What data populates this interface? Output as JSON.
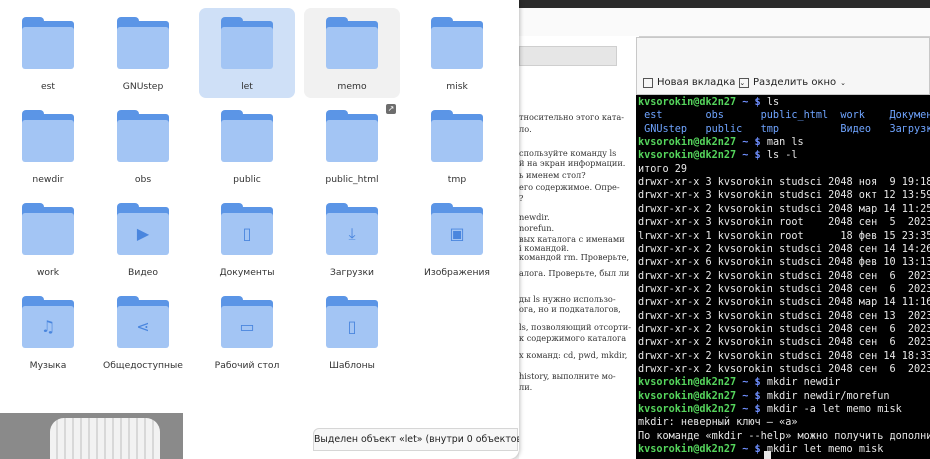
{
  "document": {
    "lines": [
      "тносительно этого ката-",
      "ло.",
      "спользуйте команду ls",
      "й на экран информации.",
      "ь именем стол?",
      "его содержимое. Опре-",
      "?",
      "newdir.",
      "norefun.",
      "вых каталога с именами",
      "і командой.",
      "командой rm. Проверьте,",
      "алога. Проверьте, был ли",
      "ды ls нужно использо-",
      "ога, но и подкаталогов,",
      "ls, позволяющий отсорти-",
      "к содержимого каталога",
      "х команд: cd, pwd, mkdir,",
      "history, выполните мо-",
      "ли."
    ]
  },
  "terminal": {
    "toolbar": {
      "new_tab": "Новая вкладка",
      "split": "Разделить окно"
    },
    "lines": [
      [
        {
          "t": "kvsorokin@dk2n27",
          "c": "u"
        },
        {
          "t": " ~ $ ",
          "c": "p"
        },
        {
          "t": "ls",
          "c": ""
        }
      ],
      [
        {
          "t": " est       obs      public_html  work    Докумен",
          "c": "d"
        }
      ],
      [
        {
          "t": " GNUstep   public   tmp          Видео   Загрузк",
          "c": "d"
        }
      ],
      [
        {
          "t": "kvsorokin@dk2n27",
          "c": "u"
        },
        {
          "t": " ~ $ ",
          "c": "p"
        },
        {
          "t": "man ls",
          "c": ""
        }
      ],
      [
        {
          "t": "kvsorokin@dk2n27",
          "c": "u"
        },
        {
          "t": " ~ $ ",
          "c": "p"
        },
        {
          "t": "ls -l",
          "c": ""
        }
      ],
      [
        {
          "t": "итого 29",
          "c": ""
        }
      ],
      [
        {
          "t": "drwxr-xr-x 3 kvsorokin studsci 2048 ноя  9 19:18",
          "c": ""
        }
      ],
      [
        {
          "t": "drwxr-xr-x 3 kvsorokin studsci 2048 окт 12 13:59",
          "c": ""
        }
      ],
      [
        {
          "t": "drwxr-xr-x 2 kvsorokin studsci 2048 мар 14 11:25",
          "c": ""
        }
      ],
      [
        {
          "t": "drwxr-xr-x 3 kvsorokin root    2048 сен  5  2023",
          "c": ""
        }
      ],
      [
        {
          "t": "lrwxr-xr-x 1 kvsorokin root      18 фев 15 23:35",
          "c": ""
        }
      ],
      [
        {
          "t": "drwxr-xr-x 2 kvsorokin studsci 2048 сен 14 14:26",
          "c": ""
        }
      ],
      [
        {
          "t": "drwxr-xr-x 6 kvsorokin studsci 2048 фев 10 13:13",
          "c": ""
        }
      ],
      [
        {
          "t": "drwxr-xr-x 2 kvsorokin studsci 2048 сен  6  2023",
          "c": ""
        }
      ],
      [
        {
          "t": "drwxr-xr-x 2 kvsorokin studsci 2048 сен  6  2023",
          "c": ""
        }
      ],
      [
        {
          "t": "drwxr-xr-x 2 kvsorokin studsci 2048 мар 14 11:16",
          "c": ""
        }
      ],
      [
        {
          "t": "drwxr-xr-x 3 kvsorokin studsci 2048 сен 13  2023",
          "c": ""
        }
      ],
      [
        {
          "t": "drwxr-xr-x 2 kvsorokin studsci 2048 сен  6  2023",
          "c": ""
        }
      ],
      [
        {
          "t": "drwxr-xr-x 2 kvsorokin studsci 2048 сен  6  2023",
          "c": ""
        }
      ],
      [
        {
          "t": "drwxr-xr-x 2 kvsorokin studsci 2048 сен 14 18:33",
          "c": ""
        }
      ],
      [
        {
          "t": "drwxr-xr-x 2 kvsorokin studsci 2048 сен  6  2023",
          "c": ""
        }
      ],
      [
        {
          "t": "kvsorokin@dk2n27",
          "c": "u"
        },
        {
          "t": " ~ $ ",
          "c": "p"
        },
        {
          "t": "mkdir newdir",
          "c": ""
        }
      ],
      [
        {
          "t": "kvsorokin@dk2n27",
          "c": "u"
        },
        {
          "t": " ~ $ ",
          "c": "p"
        },
        {
          "t": "mkdir newdir/morefun",
          "c": ""
        }
      ],
      [
        {
          "t": "kvsorokin@dk2n27",
          "c": "u"
        },
        {
          "t": " ~ $ ",
          "c": "p"
        },
        {
          "t": "mkdir -a let memo misk",
          "c": ""
        }
      ],
      [
        {
          "t": "mkdir: неверный ключ — «a»",
          "c": ""
        }
      ],
      [
        {
          "t": "По команде «mkdir --help» можно получить дополнит",
          "c": ""
        }
      ],
      [
        {
          "t": "kvsorokin@dk2n27",
          "c": "u"
        },
        {
          "t": " ~ $ ",
          "c": "p"
        },
        {
          "t": "mkdir let memo misk",
          "c": ""
        }
      ]
    ]
  },
  "file_manager": {
    "items": [
      {
        "name": "est",
        "icon": "folder-icon",
        "glyph": "",
        "state": ""
      },
      {
        "name": "GNUstep",
        "icon": "folder-icon",
        "glyph": "",
        "state": ""
      },
      {
        "name": "let",
        "icon": "folder-icon",
        "glyph": "",
        "state": "selected"
      },
      {
        "name": "memo",
        "icon": "folder-icon",
        "glyph": "",
        "state": "hovered"
      },
      {
        "name": "misk",
        "icon": "folder-icon",
        "glyph": "",
        "state": ""
      },
      {
        "name": "newdir",
        "icon": "folder-icon",
        "glyph": "",
        "state": ""
      },
      {
        "name": "obs",
        "icon": "folder-icon",
        "glyph": "",
        "state": ""
      },
      {
        "name": "public",
        "icon": "folder-icon",
        "glyph": "",
        "state": ""
      },
      {
        "name": "public_html",
        "icon": "folder-icon",
        "glyph": "",
        "state": ""
      },
      {
        "name": "tmp",
        "icon": "folder-icon",
        "glyph": "",
        "state": ""
      },
      {
        "name": "work",
        "icon": "folder-icon",
        "glyph": "",
        "state": ""
      },
      {
        "name": "Видео",
        "icon": "folder-videos-icon",
        "glyph": "▶",
        "state": ""
      },
      {
        "name": "Документы",
        "icon": "folder-documents-icon",
        "glyph": "▯",
        "state": ""
      },
      {
        "name": "Загрузки",
        "icon": "folder-download-icon",
        "glyph": "⤓",
        "state": ""
      },
      {
        "name": "Изображения",
        "icon": "folder-pictures-icon",
        "glyph": "▣",
        "state": ""
      },
      {
        "name": "Музыка",
        "icon": "folder-music-icon",
        "glyph": "♫",
        "state": ""
      },
      {
        "name": "Общедоступные",
        "icon": "folder-publicshare-icon",
        "glyph": "⋖",
        "state": ""
      },
      {
        "name": "Рабочий стол",
        "icon": "folder-desktop-icon",
        "glyph": "▭",
        "state": ""
      },
      {
        "name": "Шаблоны",
        "icon": "folder-templates-icon",
        "glyph": "▯",
        "state": ""
      }
    ],
    "status": "Выделен объект «let» (внутри 0 объектов)",
    "colors": {
      "folder_back": "#5b95e6",
      "folder_front": "#a3c5f4",
      "selection": "#cfe0f7"
    }
  }
}
